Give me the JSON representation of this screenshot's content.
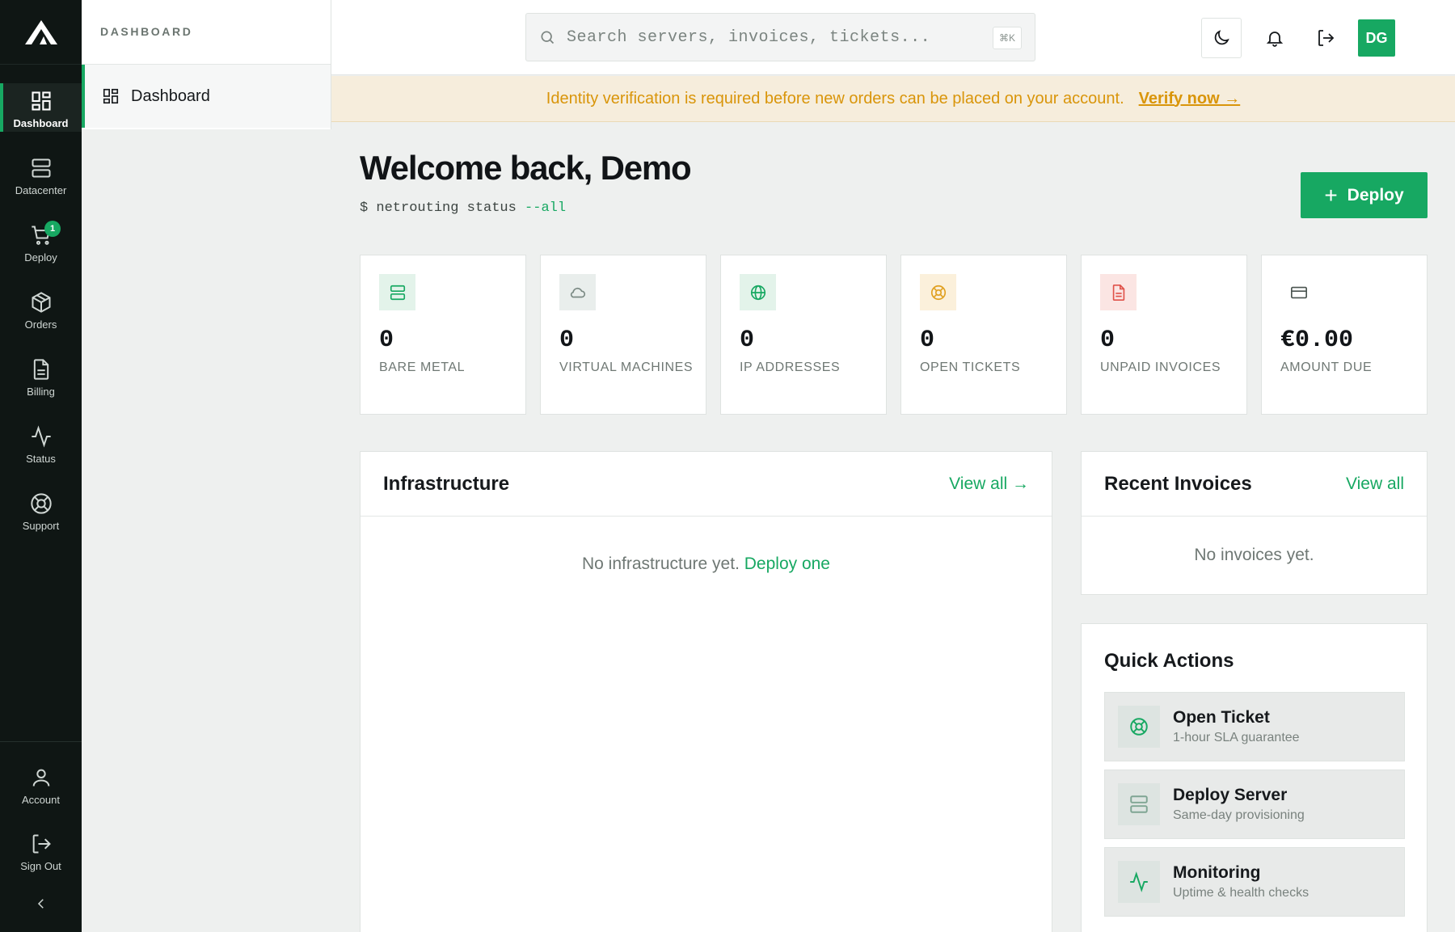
{
  "rail": {
    "items": [
      {
        "label": "Dashboard"
      },
      {
        "label": "Datacenter"
      },
      {
        "label": "Deploy",
        "badge": "1"
      },
      {
        "label": "Orders"
      },
      {
        "label": "Billing"
      },
      {
        "label": "Status"
      },
      {
        "label": "Support"
      }
    ],
    "bottom": [
      {
        "label": "Account"
      },
      {
        "label": "Sign Out"
      }
    ]
  },
  "subnav": {
    "header": "DASHBOARD",
    "items": [
      {
        "label": "Dashboard"
      }
    ]
  },
  "topbar": {
    "search_placeholder": "Search servers, invoices, tickets...",
    "shortcut": "⌘K",
    "avatar_initials": "DG"
  },
  "banner": {
    "message": "Identity verification is required before new orders can be placed on your account.",
    "link": "Verify now →"
  },
  "header": {
    "title": "Welcome back, Demo",
    "cmd_prefix": "$ netrouting status ",
    "cmd_flag": "--all",
    "deploy_label": "Deploy",
    "deploy_icon": "+"
  },
  "stats": [
    {
      "value": "0",
      "label": "BARE METAL",
      "icon": "server-icon"
    },
    {
      "value": "0",
      "label": "VIRTUAL MACHINES",
      "icon": "cloud-icon"
    },
    {
      "value": "0",
      "label": "IP ADDRESSES",
      "icon": "globe-icon"
    },
    {
      "value": "0",
      "label": "OPEN TICKETS",
      "icon": "lifebuoy-icon"
    },
    {
      "value": "0",
      "label": "UNPAID INVOICES",
      "icon": "document-icon"
    },
    {
      "value": "€0.00",
      "label": "AMOUNT DUE",
      "icon": "card-icon"
    }
  ],
  "infrastructure": {
    "title": "Infrastructure",
    "view_all": "View all →",
    "empty_text": "No infrastructure yet.",
    "empty_link": "Deploy one"
  },
  "invoices": {
    "title": "Recent Invoices",
    "view_all": "View all",
    "empty_text": "No invoices yet."
  },
  "quick_actions": {
    "title": "Quick Actions",
    "items": [
      {
        "name": "Open Ticket",
        "sub": "1-hour SLA guarantee"
      },
      {
        "name": "Deploy Server",
        "sub": "Same-day provisioning"
      },
      {
        "name": "Monitoring",
        "sub": "Uptime & health checks"
      }
    ]
  },
  "colors": {
    "accent": "#17a862",
    "rail_bg": "#0f1614",
    "warning": "#d9950a",
    "danger": "#e0524a"
  }
}
